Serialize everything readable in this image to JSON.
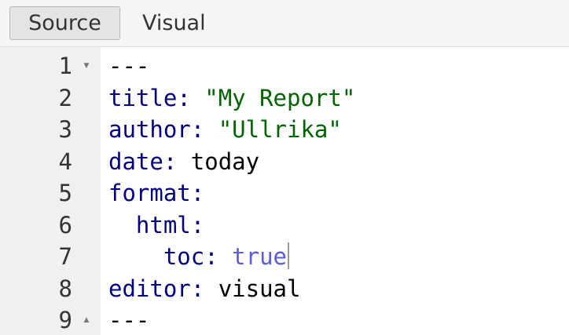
{
  "toolbar": {
    "source_label": "Source",
    "visual_label": "Visual"
  },
  "colors": {
    "key": "#000080",
    "string": "#006400",
    "boolean": "#5b5bdc",
    "gutter_bg": "#f0f0f0"
  },
  "icons": {
    "fold_open": "caret-down-icon",
    "fold_close": "caret-up-icon"
  },
  "editor": {
    "lines": [
      {
        "num": "1",
        "delim": "---"
      },
      {
        "num": "2",
        "key": "title",
        "colon": ":",
        "value": "\"My Report\""
      },
      {
        "num": "3",
        "key": "author",
        "colon": ":",
        "value": "\"Ullrika\""
      },
      {
        "num": "4",
        "key": "date",
        "colon": ":",
        "value": "today"
      },
      {
        "num": "5",
        "key": "format",
        "colon": ":"
      },
      {
        "num": "6",
        "key": "html",
        "colon": ":"
      },
      {
        "num": "7",
        "key": "toc",
        "colon": ":",
        "value": "true"
      },
      {
        "num": "8",
        "key": "editor",
        "colon": ":",
        "value": "visual"
      },
      {
        "num": "9",
        "delim": "---"
      }
    ]
  }
}
